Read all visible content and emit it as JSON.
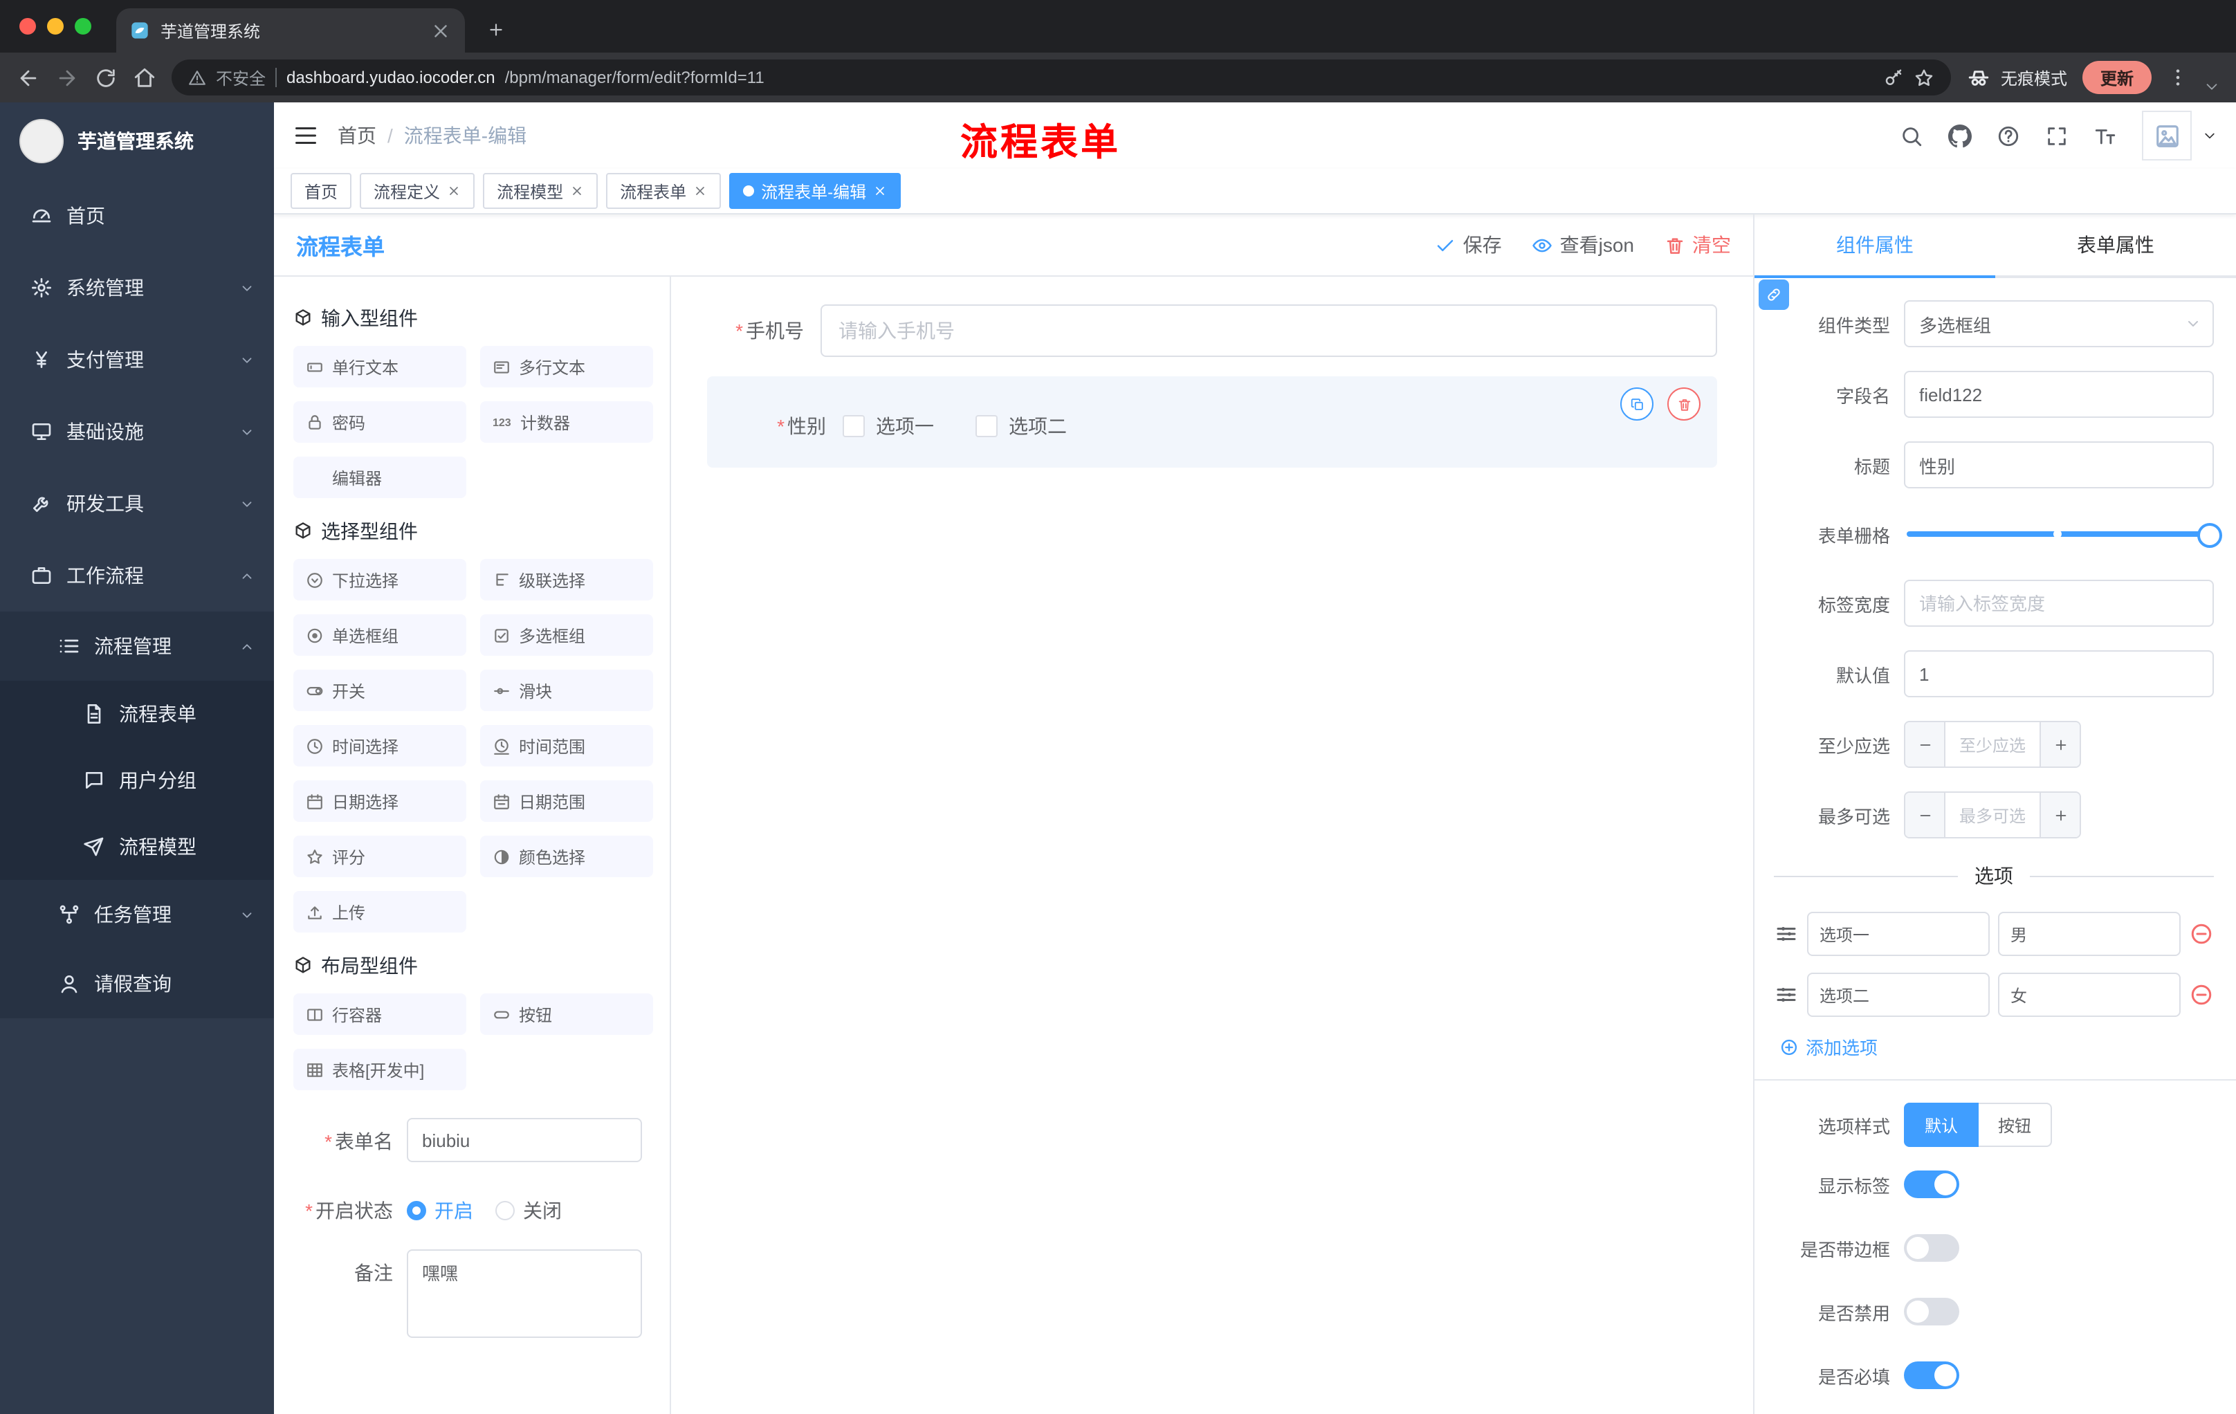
{
  "browser": {
    "tab_title": "芋道管理系统",
    "security_label": "不安全",
    "url_domain": "dashboard.yudao.iocoder.cn",
    "url_path": "/bpm/manager/form/edit?formId=11",
    "incognito_label": "无痕模式",
    "update_label": "更新",
    "icons": [
      "back-icon",
      "forward-icon",
      "reload-icon",
      "home-icon",
      "warning-icon",
      "key-icon",
      "star-icon",
      "incognito-icon",
      "more-vertical-icon"
    ]
  },
  "sidebar": {
    "app_title": "芋道管理系统",
    "items": [
      {
        "label": "首页",
        "icon": "dashboard-icon"
      },
      {
        "label": "系统管理",
        "icon": "gear-icon"
      },
      {
        "label": "支付管理",
        "icon": "yen-icon"
      },
      {
        "label": "基础设施",
        "icon": "monitor-icon"
      },
      {
        "label": "研发工具",
        "icon": "tool-icon"
      },
      {
        "label": "工作流程",
        "icon": "briefcase-icon"
      },
      {
        "label": "流程管理",
        "icon": "list-icon"
      },
      {
        "label": "流程表单",
        "icon": "document-icon"
      },
      {
        "label": "用户分组",
        "icon": "chat-icon"
      },
      {
        "label": "流程模型",
        "icon": "paper-plane-icon"
      },
      {
        "label": "任务管理",
        "icon": "tree-icon"
      },
      {
        "label": "请假查询",
        "icon": "user-icon"
      }
    ]
  },
  "topbar": {
    "breadcrumb_home": "首页",
    "breadcrumb_separator": "/",
    "breadcrumb_current": "流程表单-编辑",
    "annotation": "流程表单",
    "icons": [
      "search-icon",
      "github-icon",
      "help-icon",
      "fullscreen-icon",
      "font-size-icon",
      "avatar-broken-image-icon",
      "caret-down-icon"
    ]
  },
  "tags": [
    {
      "label": "首页"
    },
    {
      "label": "流程定义"
    },
    {
      "label": "流程模型"
    },
    {
      "label": "流程表单"
    },
    {
      "label": "流程表单-编辑"
    }
  ],
  "designer": {
    "title": "流程表单",
    "save_label": "保存",
    "view_json_label": "查看json",
    "clear_label": "清空",
    "groups": [
      {
        "title": "输入型组件",
        "items": [
          {
            "label": "单行文本",
            "icon": "input-icon"
          },
          {
            "label": "多行文本",
            "icon": "textarea-icon"
          },
          {
            "label": "密码",
            "icon": "lock-icon"
          },
          {
            "label": "计数器",
            "icon": "counter-icon"
          },
          {
            "label": "编辑器",
            "icon": "editor-icon"
          }
        ]
      },
      {
        "title": "选择型组件",
        "items": [
          {
            "label": "下拉选择",
            "icon": "dropdown-icon"
          },
          {
            "label": "级联选择",
            "icon": "cascade-icon"
          },
          {
            "label": "单选框组",
            "icon": "radio-icon"
          },
          {
            "label": "多选框组",
            "icon": "checkbox-icon"
          },
          {
            "label": "开关",
            "icon": "switch-icon"
          },
          {
            "label": "滑块",
            "icon": "slider-icon"
          },
          {
            "label": "时间选择",
            "icon": "clock-icon"
          },
          {
            "label": "时间范围",
            "icon": "clock-range-icon"
          },
          {
            "label": "日期选择",
            "icon": "calendar-icon"
          },
          {
            "label": "日期范围",
            "icon": "calendar-range-icon"
          },
          {
            "label": "评分",
            "icon": "star-icon"
          },
          {
            "label": "颜色选择",
            "icon": "color-icon"
          },
          {
            "label": "上传",
            "icon": "upload-icon"
          }
        ]
      },
      {
        "title": "布局型组件",
        "items": [
          {
            "label": "行容器",
            "icon": "row-container-icon"
          },
          {
            "label": "按钮",
            "icon": "button-icon"
          },
          {
            "label": "表格[开发中]",
            "icon": "table-icon"
          }
        ]
      }
    ],
    "form": {
      "name_label": "表单名",
      "name_value": "biubiu",
      "status_label": "开启状态",
      "status_on": "开启",
      "status_off": "关闭",
      "remark_label": "备注",
      "remark_value": "嘿嘿"
    }
  },
  "canvas": {
    "phone_label": "手机号",
    "phone_placeholder": "请输入手机号",
    "gender_label": "性别",
    "gender_options": [
      "选项一",
      "选项二"
    ]
  },
  "props": {
    "tab_component": "组件属性",
    "tab_form": "表单属性",
    "type_label": "组件类型",
    "type_value": "多选框组",
    "field_label": "字段名",
    "field_value": "field122",
    "title_label": "标题",
    "title_value": "性别",
    "grid_label": "表单栅格",
    "label_width_label": "标签宽度",
    "label_width_placeholder": "请输入标签宽度",
    "default_label": "默认值",
    "default_value": "1",
    "min_label": "至少应选",
    "min_placeholder": "至少应选",
    "max_label": "最多可选",
    "max_placeholder": "最多可选",
    "options_title": "选项",
    "options": [
      {
        "label": "选项一",
        "value": "男"
      },
      {
        "label": "选项二",
        "value": "女"
      }
    ],
    "add_option_label": "添加选项",
    "style_label": "选项样式",
    "style_default": "默认",
    "style_button": "按钮",
    "toggles": [
      {
        "label": "显示标签",
        "on": true
      },
      {
        "label": "是否带边框",
        "on": false
      },
      {
        "label": "是否禁用",
        "on": false
      },
      {
        "label": "是否必填",
        "on": true
      }
    ]
  },
  "misc": {
    "required_mark": "*"
  },
  "colors": {
    "accent": "#409EFF",
    "danger": "#F56C6C",
    "annotation": "#FF0000",
    "sidebar_bg": "#2F3A4C",
    "tag_active": "#409EFF"
  }
}
